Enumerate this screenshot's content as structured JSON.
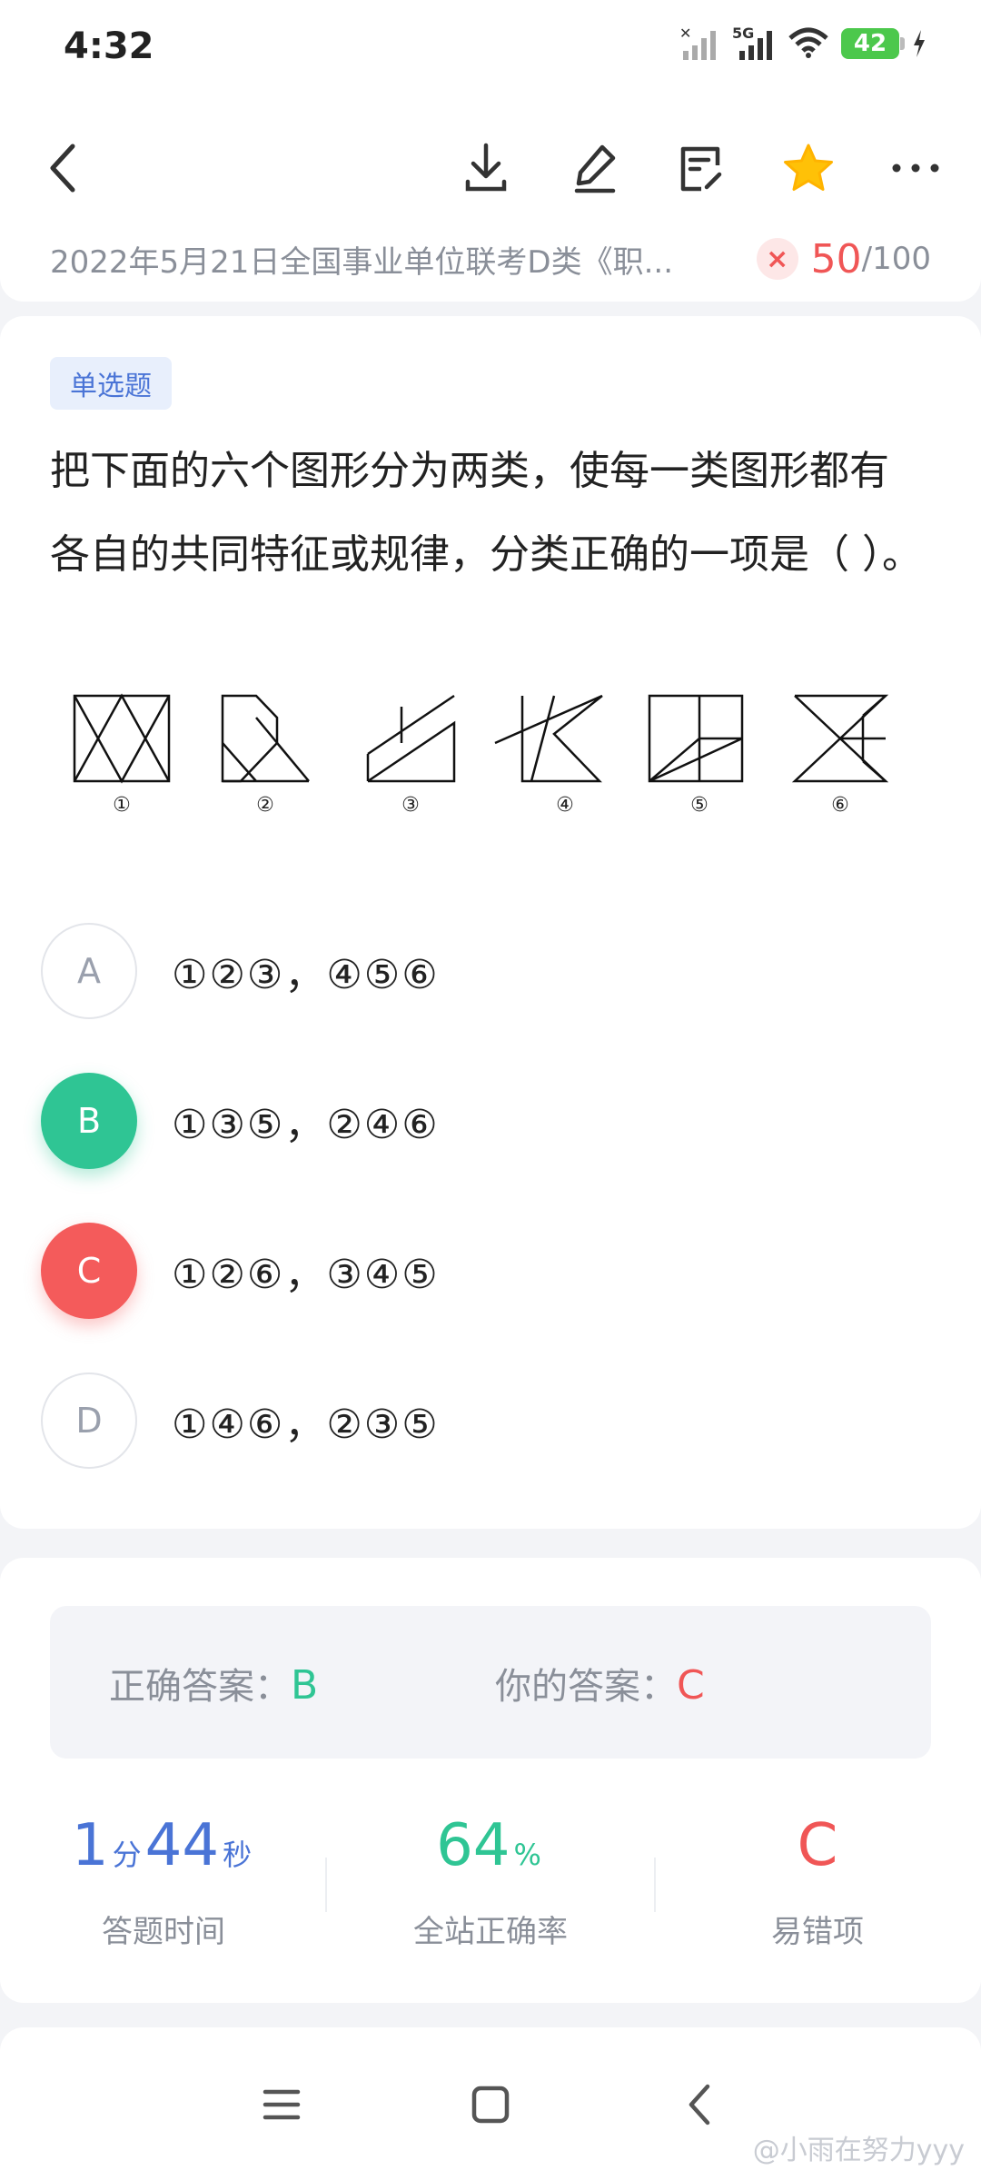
{
  "status_bar": {
    "time": "4:32",
    "battery": "42",
    "network": "5G"
  },
  "toolbar": {
    "back_icon": "chevron-left-icon",
    "download_icon": "download-icon",
    "edit_icon": "pencil-icon",
    "notes_icon": "notes-icon",
    "favorite_icon": "star-icon",
    "more_icon": "more-icon",
    "favorite_color": "#ffc107"
  },
  "exam": {
    "title": "2022年5月21日全国事业单位联考D类《职...",
    "wrong_mark": "×",
    "score": "50",
    "total": "/100"
  },
  "question": {
    "type_tag": "单选题",
    "text": "把下面的六个图形分为两类，使每一类图形都有各自的共同特征或规律，分类正确的一项是（    ）。",
    "figure_labels": [
      "①",
      "②",
      "③",
      "④",
      "⑤",
      "⑥"
    ]
  },
  "options": [
    {
      "letter": "A",
      "text": "①②③，④⑤⑥",
      "state": "normal"
    },
    {
      "letter": "B",
      "text": "①③⑤，②④⑥",
      "state": "correct"
    },
    {
      "letter": "C",
      "text": "①②⑥，③④⑤",
      "state": "wrong"
    },
    {
      "letter": "D",
      "text": "①④⑥，②③⑤",
      "state": "normal"
    }
  ],
  "answer": {
    "correct_label": "正确答案：",
    "correct_value": "B",
    "mine_label": "你的答案：",
    "mine_value": "C"
  },
  "stats": {
    "time_minutes": "1",
    "time_min_unit": "分",
    "time_seconds": "44",
    "time_sec_unit": "秒",
    "time_label": "答题时间",
    "accuracy_value": "64",
    "accuracy_unit": "%",
    "accuracy_label": "全站正确率",
    "error_option": "C",
    "error_label": "易错项"
  },
  "nav": {
    "menu_icon": "menu-icon",
    "home_icon": "home-icon",
    "back_icon": "back-icon"
  },
  "watermark": "@小雨在努力yyy",
  "colors": {
    "correct": "#2fc594",
    "wrong": "#f05656",
    "accent_blue": "#4a74d6"
  }
}
